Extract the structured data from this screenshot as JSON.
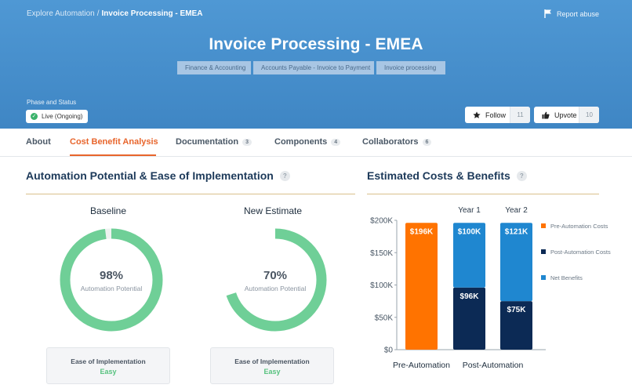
{
  "breadcrumb": {
    "parent": "Explore Automation",
    "separator": "/",
    "current": "Invoice Processing - EMEA"
  },
  "report_abuse": "Report abuse",
  "title": "Invoice Processing - EMEA",
  "category_path": [
    "Finance & Accounting",
    "Accounts Payable - Invoice to Payment",
    "Invoice processing"
  ],
  "phase": {
    "label": "Phase and Status",
    "value": "Live (Ongoing)"
  },
  "follow": {
    "label": "Follow",
    "count": "11"
  },
  "upvote": {
    "label": "Upvote",
    "count": "10"
  },
  "tabs": [
    {
      "label": "About",
      "badge": ""
    },
    {
      "label": "Cost Benefit Analysis",
      "badge": ""
    },
    {
      "label": "Documentation",
      "badge": "3"
    },
    {
      "label": "Components",
      "badge": "4"
    },
    {
      "label": "Collaborators",
      "badge": "6"
    }
  ],
  "active_tab": "Cost Benefit Analysis",
  "potential": {
    "title": "Automation Potential & Ease of Implementation",
    "help": "?",
    "baseline": {
      "label": "Baseline",
      "value_text": "98%",
      "value": 0.98,
      "sub": "Automation Potential",
      "ease_label": "Ease of Implementation",
      "ease_value": "Easy"
    },
    "estimate": {
      "label": "New Estimate",
      "value_text": "70%",
      "value": 0.7,
      "sub": "Automation Potential",
      "ease_label": "Ease of Implementation",
      "ease_value": "Easy"
    }
  },
  "costs": {
    "title": "Estimated Costs & Benefits",
    "help": "?"
  },
  "colors": {
    "accent": "#e8652c",
    "donut": "#6fcf97",
    "donut_track": "#ffffff",
    "orange": "#ff7300",
    "navy": "#0c2a55",
    "blue": "#1f87d0"
  },
  "chart_data": {
    "type": "bar",
    "stacked": true,
    "categories": [
      "Pre-Automation",
      "Year 1",
      "Year 2"
    ],
    "group_labels": [
      "Pre-Automation",
      "Post-Automation"
    ],
    "y_ticks": [
      "$0",
      "$50K",
      "$100K",
      "$150K",
      "$200K"
    ],
    "ylim": [
      0,
      200000
    ],
    "series": [
      {
        "name": "Pre-Automation Costs",
        "color": "#ff7300",
        "values": [
          196000,
          0,
          0
        ],
        "labels": [
          "$196K",
          "",
          ""
        ]
      },
      {
        "name": "Post-Automation Costs",
        "color": "#0c2a55",
        "values": [
          0,
          96000,
          75000
        ],
        "labels": [
          "",
          "$96K",
          "$75K"
        ]
      },
      {
        "name": "Net Benefits",
        "color": "#1f87d0",
        "values": [
          0,
          100000,
          121000
        ],
        "labels": [
          "",
          "$100K",
          "$121K"
        ]
      }
    ],
    "legend_placement": "right"
  }
}
